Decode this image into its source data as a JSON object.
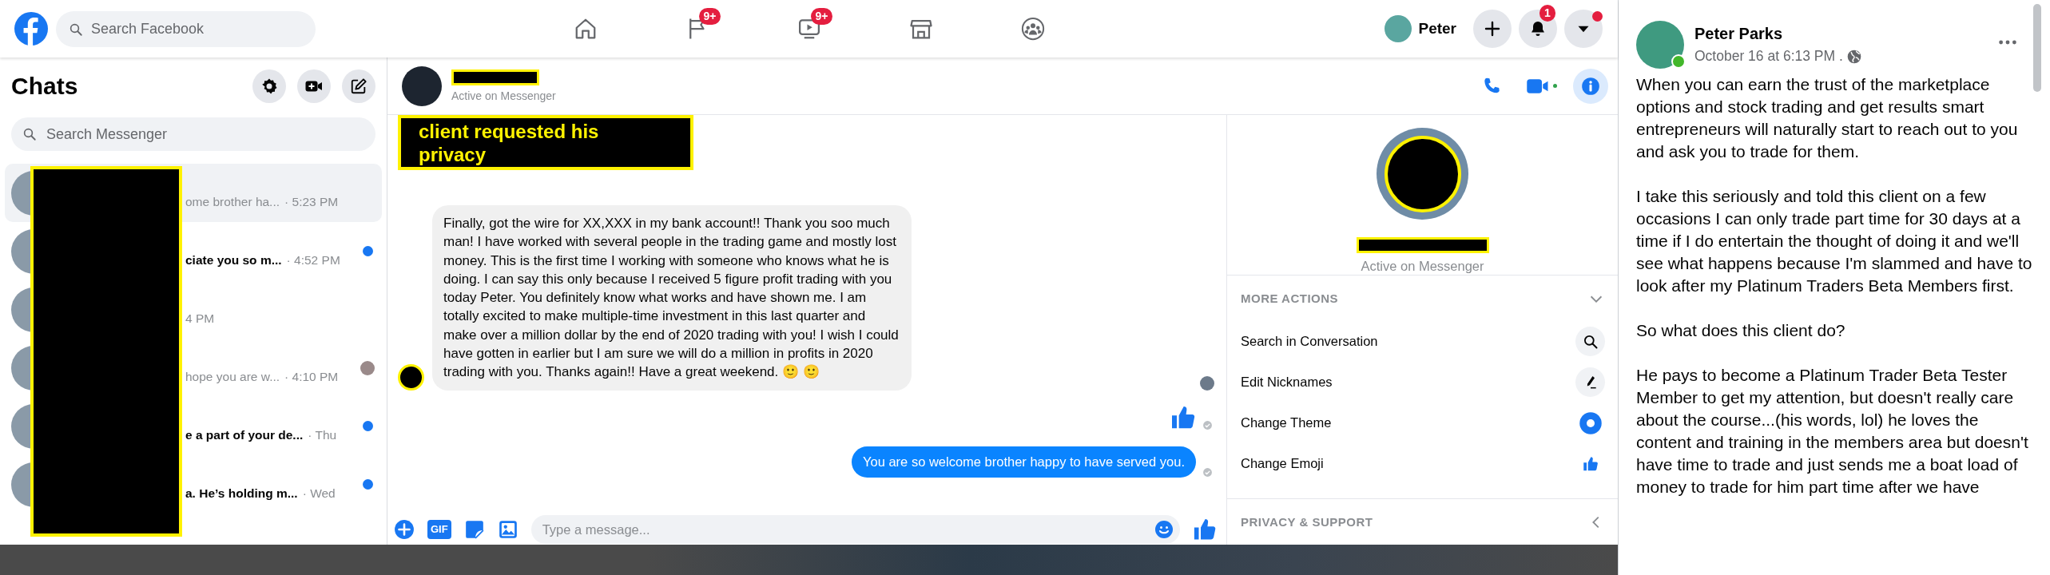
{
  "top_bar": {
    "search": {
      "placeholder": "Search Facebook"
    },
    "nav": [
      {
        "kind": "home"
      },
      {
        "kind": "pages",
        "badge": "9+"
      },
      {
        "kind": "watch",
        "badge": "9+"
      },
      {
        "kind": "marketplace"
      },
      {
        "kind": "groups"
      }
    ],
    "profile": {
      "name": "Peter"
    },
    "actions": [
      {
        "kind": "create"
      },
      {
        "kind": "notifications",
        "badge": "1"
      },
      {
        "kind": "account",
        "dot": true
      }
    ]
  },
  "chats": {
    "title": "Chats",
    "search": {
      "placeholder": "Search Messenger"
    },
    "items": [
      {
        "preview": "ome brother ha...",
        "time": "· 5:23 PM",
        "selected": true,
        "unread": false,
        "seen": false
      },
      {
        "preview": "ciate you so m...",
        "time": "· 4:52 PM",
        "selected": false,
        "unread": true,
        "seen": false
      },
      {
        "time": "4 PM",
        "selected": false,
        "unread": false,
        "seen": false
      },
      {
        "preview": "hope you are w...",
        "time": "· 4:10 PM",
        "selected": false,
        "unread": false,
        "seen": true
      },
      {
        "preview": "e a part of your de...",
        "time": "· Thu",
        "selected": false,
        "unread": true,
        "seen": false
      },
      {
        "preview": "a. He’s holding m...",
        "time": "· Wed",
        "selected": false,
        "unread": true,
        "seen": false
      }
    ]
  },
  "conversation": {
    "status": "Active on Messenger",
    "note": "client requested his privacy",
    "header_actions": [
      {
        "kind": "call",
        "selected": false
      },
      {
        "kind": "video",
        "selected": false
      },
      {
        "kind": "info",
        "selected": true
      }
    ],
    "messages": [
      {
        "kind": "received",
        "text": "Finally, got the wire for XX,XXX in my bank account!! Thank you soo much man! I have worked with several people in the trading game and mostly lost money. This is the first time I working with someone who knows what he is doing. I can say this only because I received 5 figure profit trading with you today Peter. You definitely know what works and have shown me. I am totally excited to make multiple-time investment in this last quarter and make over a million dollar by the end of 2020 trading with you! I wish I could have gotten in earlier but I am sure we will do a million in profits in 2020 trading with you. Thanks again!! Have a great weekend. 🙂 🙂"
      },
      {
        "kind": "like"
      },
      {
        "kind": "sent",
        "text": "You are so welcome brother happy to have served you."
      }
    ],
    "composer": {
      "tools": [
        {
          "kind": "more"
        },
        {
          "kind": "gif",
          "label": "GIF"
        },
        {
          "kind": "sticker"
        },
        {
          "kind": "photo"
        }
      ],
      "placeholder": "Type a message..."
    }
  },
  "info_panel": {
    "status": "Active on Messenger",
    "sections": [
      {
        "title": "MORE ACTIONS",
        "expanded": true,
        "items": [
          {
            "label": "Search in Conversation",
            "kind": "search"
          },
          {
            "label": "Edit Nicknames",
            "kind": "edit"
          },
          {
            "label": "Change Theme",
            "kind": "theme"
          },
          {
            "label": "Change Emoji",
            "kind": "emoji"
          }
        ]
      },
      {
        "title": "PRIVACY & SUPPORT",
        "expanded": false
      }
    ]
  },
  "post": {
    "author": "Peter Parks",
    "online": true,
    "time": "October 16 at 6:13 PM .",
    "paragraphs": [
      "When you can earn the trust of the marketplace options and stock trading and get results smart entrepreneurs will naturally start to reach out to you and ask you to trade for them.",
      "I take this seriously and told this client on a few occasions I can only trade part time for 30 days at a time if I do entertain the thought of doing it and we'll see what happens because I'm slammed and have to look after my Platinum Traders Beta Members first.",
      "So what does this client do?",
      "He pays to become a Platinum Trader Beta Tester Member to get my attention, but doesn't really care about the course...(his words, lol) he loves the content and training in the members area but doesn't have time to trade and just sends me a boat load of money to trade for him part time after we have"
    ]
  }
}
